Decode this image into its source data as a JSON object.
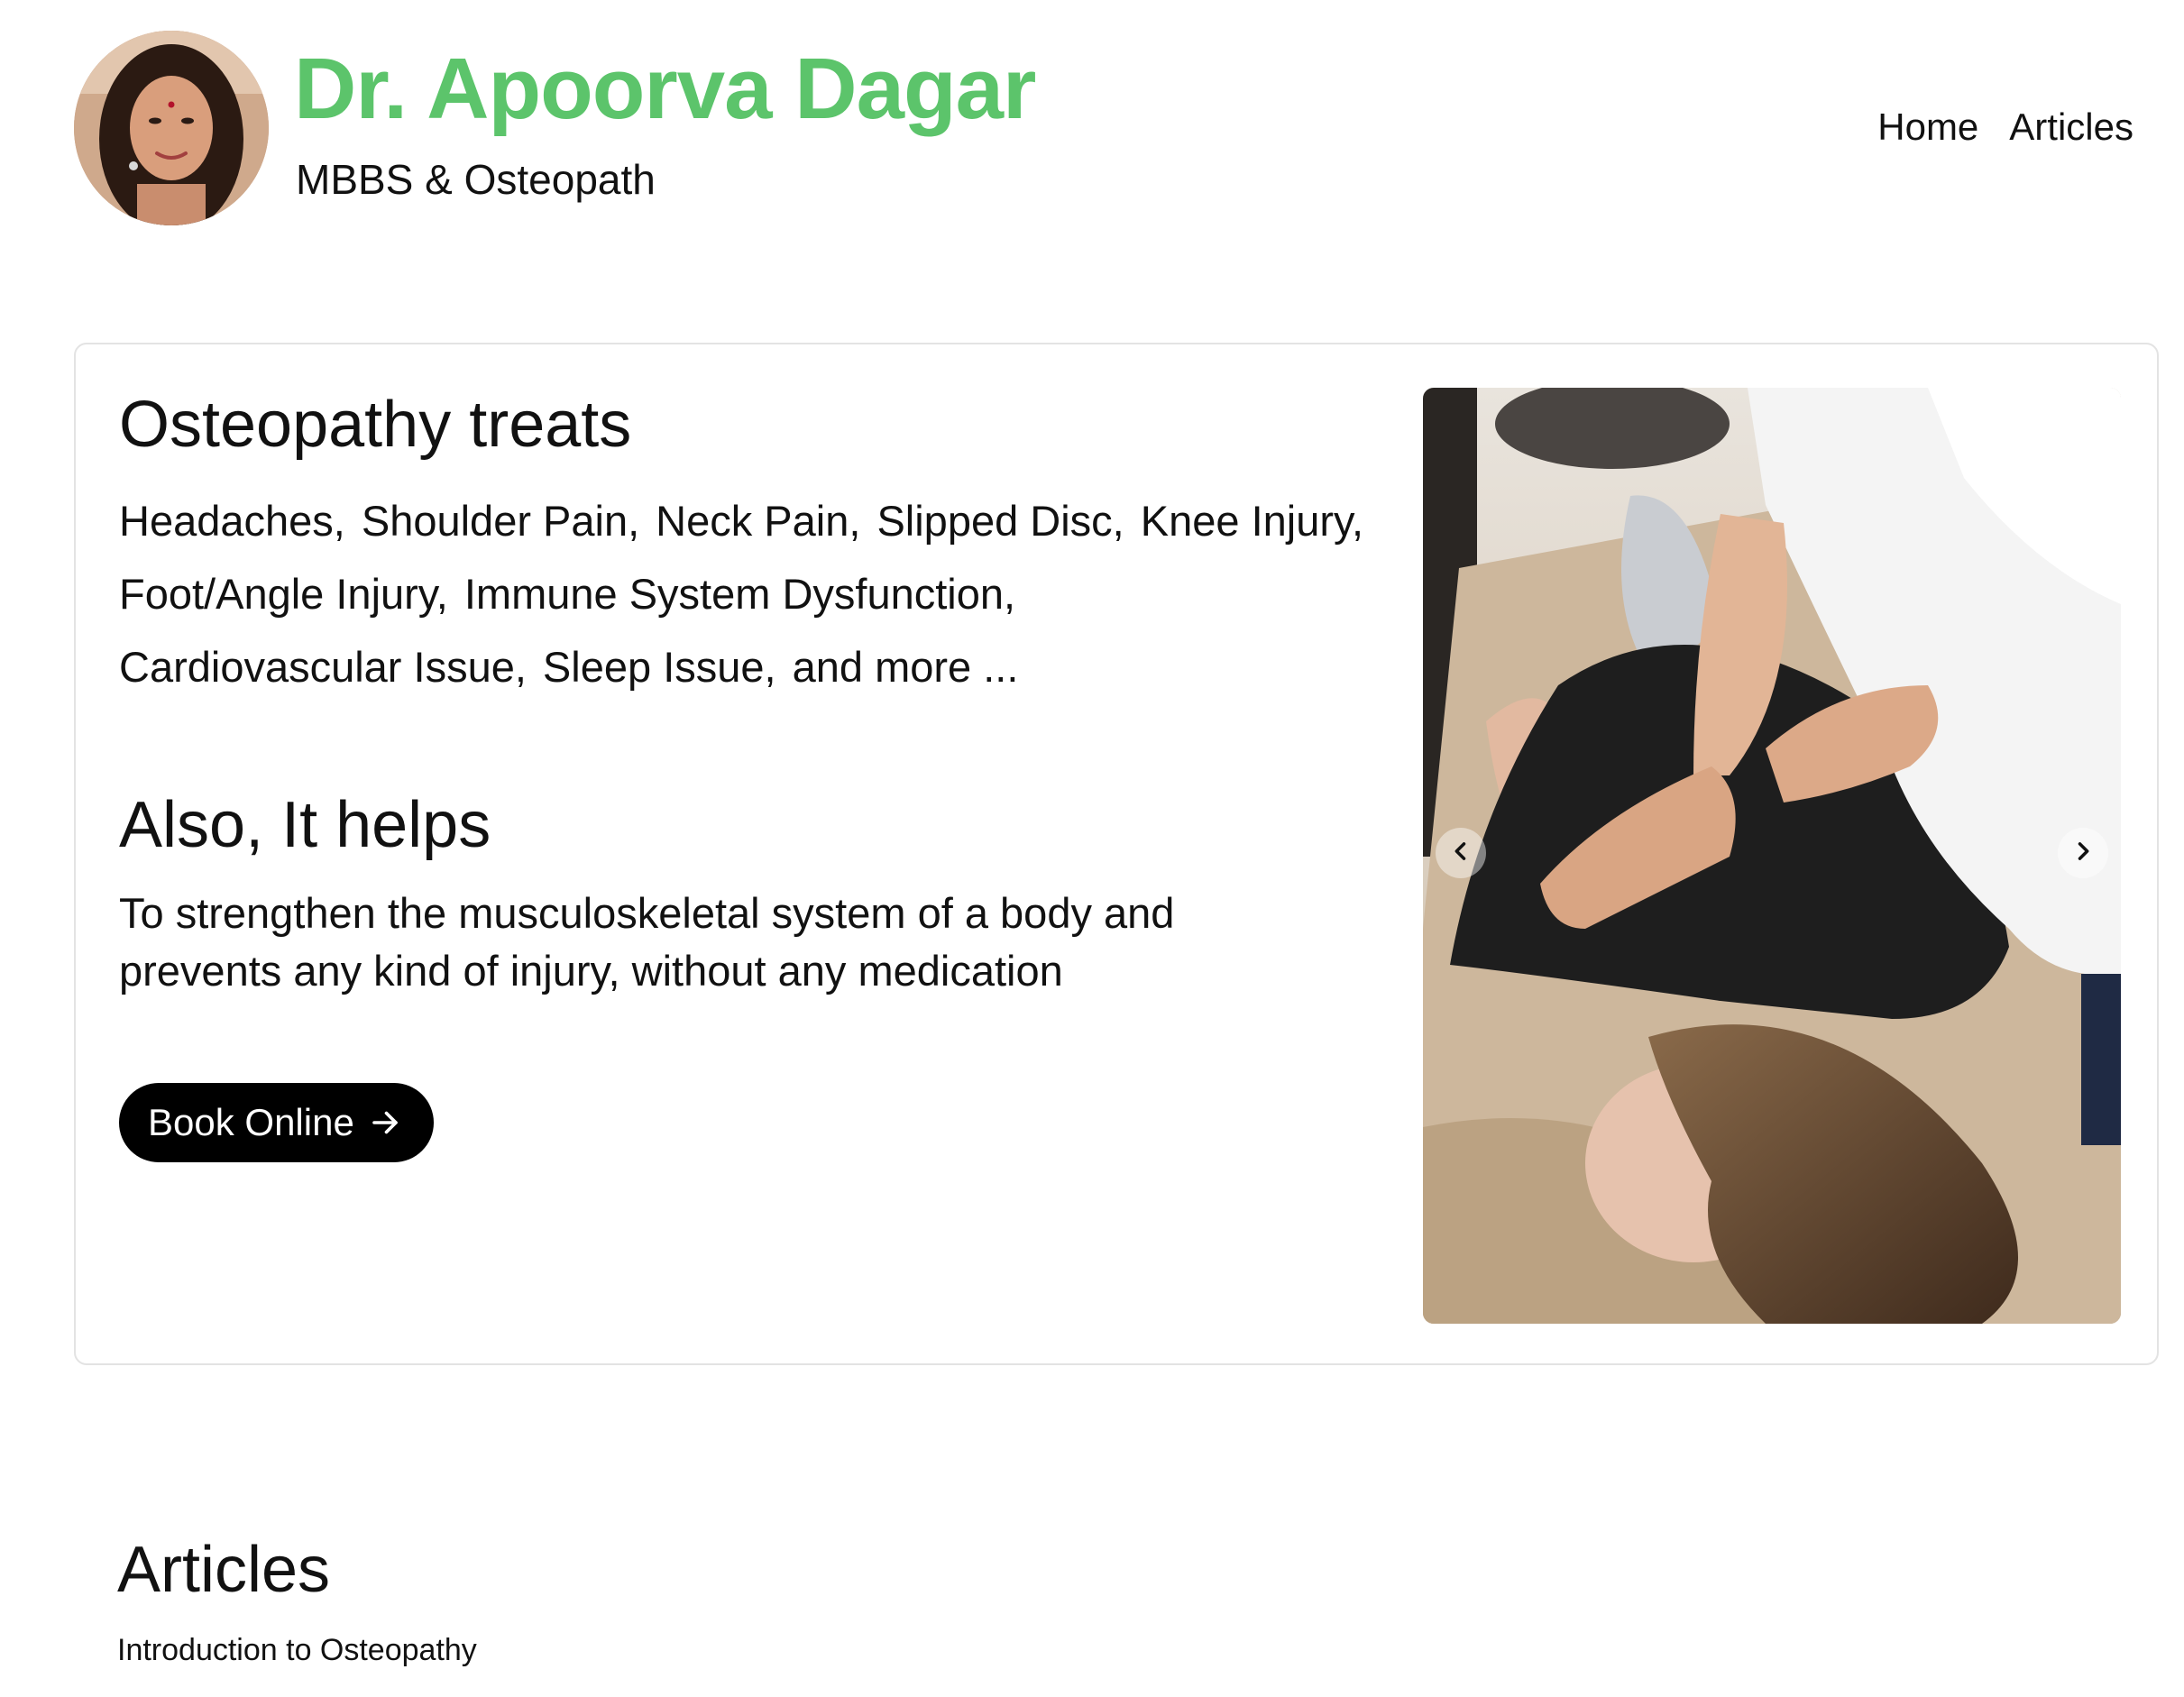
{
  "header": {
    "name": "Dr. Apoorva Dagar",
    "subtitle": "MBBS & Osteopath",
    "brand_color": "#5cc46b",
    "nav": [
      {
        "label": "Home"
      },
      {
        "label": "Articles"
      }
    ]
  },
  "hero": {
    "treats_title": "Osteopathy treats",
    "conditions": [
      "Headaches,",
      "Shoulder Pain,",
      "Neck Pain,",
      "Slipped Disc,",
      "Knee Injury,",
      "Foot/Angle Injury,",
      "Immune System Dysfunction,",
      "Cardiovascular Issue,",
      "Sleep Issue,",
      "and more ..."
    ],
    "helps_title": "Also, It helps",
    "helps_text": "To strengthen the musculoskeletal system of a body and prevents any kind of injury, without any medication",
    "book_button": "Book Online",
    "book_icon": "arrow-right-icon",
    "carousel": {
      "prev_icon": "chevron-left-icon",
      "next_icon": "chevron-right-icon"
    }
  },
  "articles": {
    "title": "Articles",
    "items": [
      {
        "title": "Introduction to Osteopathy"
      }
    ]
  }
}
